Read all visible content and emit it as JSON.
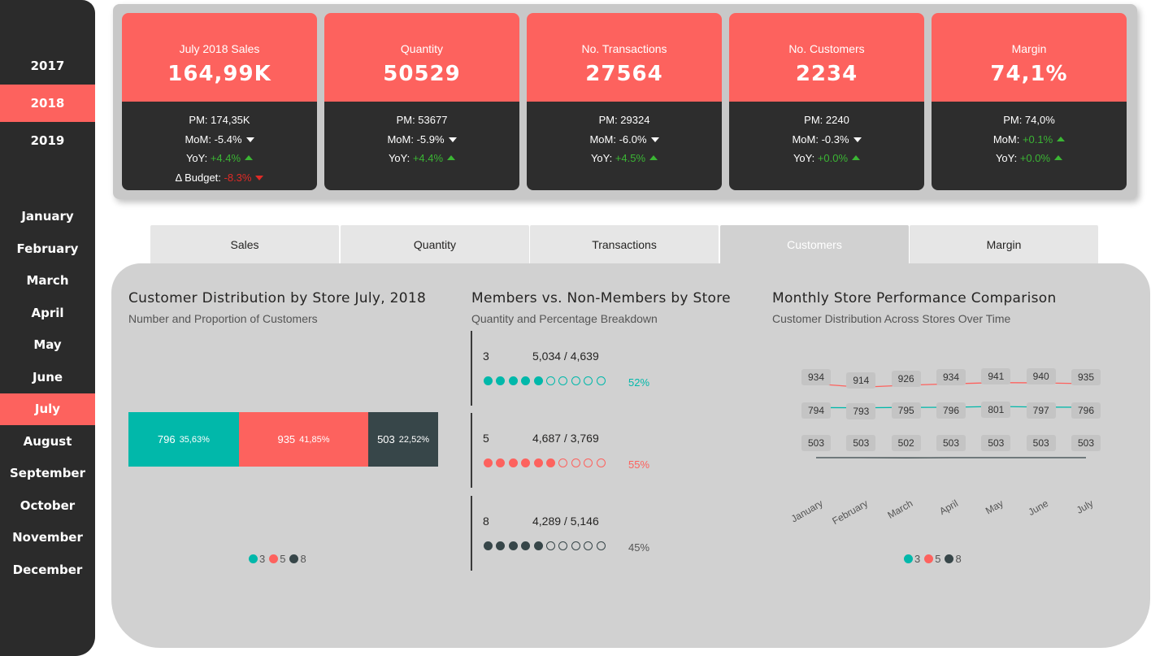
{
  "sidebar": {
    "years": [
      "2017",
      "2018",
      "2019"
    ],
    "active_year": "2018",
    "months": [
      "January",
      "February",
      "March",
      "April",
      "May",
      "June",
      "July",
      "August",
      "September",
      "October",
      "November",
      "December"
    ],
    "active_month": "July"
  },
  "kpis": [
    {
      "label": "July 2018 Sales",
      "value": "164,99K",
      "pm": "PM: 174,35K",
      "mom_label": "MoM:",
      "mom": "-5.4%",
      "mom_dir": "down",
      "yoy_label": "YoY:",
      "yoy": "+4.4%",
      "yoy_dir": "up",
      "budget_label": "Δ Budget:",
      "budget": "-8.3%",
      "budget_dir": "down"
    },
    {
      "label": "Quantity",
      "value": "50529",
      "pm": "PM: 53677",
      "mom_label": "MoM:",
      "mom": "-5.9%",
      "mom_dir": "down",
      "yoy_label": "YoY:",
      "yoy": "+4.4%",
      "yoy_dir": "up"
    },
    {
      "label": "No. Transactions",
      "value": "27564",
      "pm": "PM: 29324",
      "mom_label": "MoM:",
      "mom": "-6.0%",
      "mom_dir": "down",
      "yoy_label": "YoY:",
      "yoy": "+4.5%",
      "yoy_dir": "up"
    },
    {
      "label": "No. Customers",
      "value": "2234",
      "pm": "PM: 2240",
      "mom_label": "MoM:",
      "mom": "-0.3%",
      "mom_dir": "down",
      "yoy_label": "YoY:",
      "yoy": "+0.0%",
      "yoy_dir": "up"
    },
    {
      "label": "Margin",
      "value": "74,1%",
      "pm": "PM: 74,0%",
      "mom_label": "MoM:",
      "mom": "+0.1%",
      "mom_dir": "up",
      "yoy_label": "YoY:",
      "yoy": "+0.0%",
      "yoy_dir": "up"
    }
  ],
  "tabs": [
    "Sales",
    "Quantity",
    "Transactions",
    "Customers",
    "Margin"
  ],
  "active_tab": "Customers",
  "colors": {
    "teal": "#01b8aa",
    "red": "#fd625e",
    "dark": "#374649",
    "accent": "#fd625e"
  },
  "distribution": {
    "title": "Customer Distribution by Store July, 2018",
    "subtitle": "Number and Proportion of Customers",
    "segments": [
      {
        "store": "3",
        "value": "796",
        "pct": "35,63%"
      },
      {
        "store": "5",
        "value": "935",
        "pct": "41,85%"
      },
      {
        "store": "8",
        "value": "503",
        "pct": "22,52%"
      }
    ],
    "legend": [
      "3",
      "5",
      "8"
    ]
  },
  "members": {
    "title": "Members vs. Non-Members by Store",
    "subtitle": "Quantity and Percentage Breakdown",
    "rows": [
      {
        "store": "3",
        "values": "5,034 / 4,639",
        "pct": "52%",
        "filled": 5
      },
      {
        "store": "5",
        "values": "4,687 / 3,769",
        "pct": "55%",
        "filled": 6
      },
      {
        "store": "8",
        "values": "4,289 / 5,146",
        "pct": "45%",
        "filled": 5
      }
    ]
  },
  "chart_data": {
    "type": "line",
    "title": "Monthly Store Performance Comparison",
    "subtitle": "Customer Distribution Across Stores Over Time",
    "categories": [
      "January",
      "February",
      "March",
      "April",
      "May",
      "June",
      "July"
    ],
    "series": [
      {
        "name": "5",
        "values": [
          934,
          914,
          926,
          934,
          941,
          940,
          935
        ]
      },
      {
        "name": "3",
        "values": [
          794,
          793,
          795,
          796,
          801,
          797,
          796
        ]
      },
      {
        "name": "8",
        "values": [
          503,
          503,
          502,
          503,
          503,
          503,
          503
        ]
      }
    ],
    "legend": [
      "3",
      "5",
      "8"
    ]
  }
}
